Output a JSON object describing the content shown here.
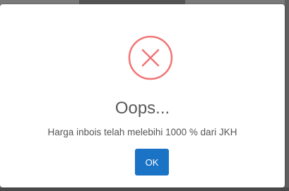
{
  "dialog": {
    "icon": "error-x-circle-icon",
    "title": "Oops...",
    "message": "Harga inbois telah melebihi 1000 % dari JKH",
    "ok_label": "OK"
  },
  "colors": {
    "error_red": "#f27474",
    "primary_button": "#1a73c4",
    "title_text": "#595959",
    "message_text": "#545454"
  }
}
